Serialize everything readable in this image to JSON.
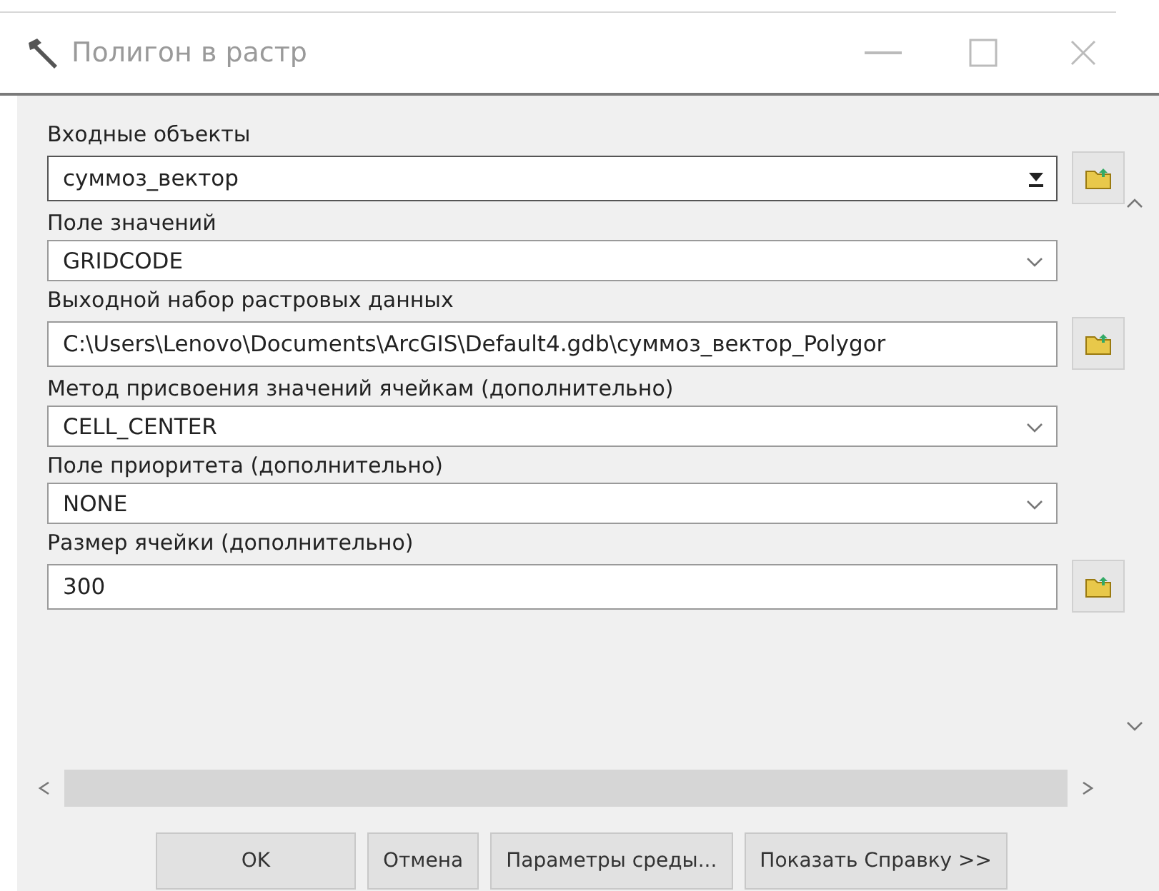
{
  "window": {
    "title": "Полигон в растр"
  },
  "parameters": [
    {
      "label": "Входные объекты",
      "value": "суммоз_вектор",
      "kind": "combo"
    },
    {
      "label": "Поле значений",
      "value": "GRIDCODE",
      "kind": "select"
    },
    {
      "label": "Выходной набор растровых данных",
      "value": "C:\\Users\\Lenovo\\Documents\\ArcGIS\\Default4.gdb\\суммоз_вектор_Polygor",
      "kind": "input"
    },
    {
      "label": "Метод присвоения значений ячейкам (дополнительно)",
      "value": "CELL_CENTER",
      "kind": "select"
    },
    {
      "label": "Поле приоритета (дополнительно)",
      "value": "NONE",
      "kind": "select"
    },
    {
      "label": "Размер ячейки (дополнительно)",
      "value": "300",
      "kind": "input"
    }
  ],
  "buttons": [
    "OK",
    "Отмена",
    "Параметры среды...",
    "Показать Справку >>"
  ]
}
